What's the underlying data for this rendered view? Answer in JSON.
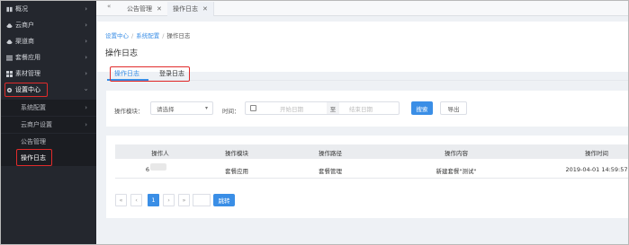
{
  "sidebar": {
    "items": [
      {
        "label": "概况",
        "icon": "book-icon"
      },
      {
        "label": "云商户",
        "icon": "cloud-icon"
      },
      {
        "label": "渠道商",
        "icon": "cloud-icon"
      },
      {
        "label": "套餐应用",
        "icon": "list-icon"
      },
      {
        "label": "素材管理",
        "icon": "grid-icon"
      },
      {
        "label": "设置中心",
        "icon": "gear-icon"
      }
    ],
    "sub_items": [
      {
        "label": "系统配置"
      },
      {
        "label": "云商户设置"
      },
      {
        "label": "公告管理"
      },
      {
        "label": "操作日志"
      }
    ]
  },
  "topbar": {
    "collapse_icon": "«",
    "tabs": [
      {
        "label": "公告管理",
        "close": "✕"
      },
      {
        "label": "操作日志",
        "close": "✕"
      }
    ]
  },
  "breadcrumb": {
    "items": [
      "设置中心",
      "系统配置",
      "操作日志"
    ],
    "separator": "/"
  },
  "page": {
    "title": "操作日志"
  },
  "subtabs": [
    "操作日志",
    "登录日志"
  ],
  "filter": {
    "module_label": "操作模块：",
    "module_placeholder": "请选择",
    "time_label": "时间：",
    "start_placeholder": "开始日期",
    "range_sep": "至",
    "end_placeholder": "结束日期",
    "search_label": "搜索",
    "export_label": "导出"
  },
  "table": {
    "headers": [
      "操作人",
      "操作模块",
      "操作路径",
      "操作内容",
      "操作时间"
    ],
    "rows": [
      [
        "6",
        "套餐应用",
        "套餐管理",
        "新建套餐\"测试\"",
        "2019-04-01 14:59:57"
      ]
    ]
  },
  "pagination": {
    "first": "«",
    "prev": "‹",
    "current": "1",
    "next": "›",
    "last": "»",
    "go_label": "跳转"
  },
  "colors": {
    "accent": "#3a8ee6",
    "sidebar_bg": "#24272e",
    "highlight": "#e12b2b"
  }
}
